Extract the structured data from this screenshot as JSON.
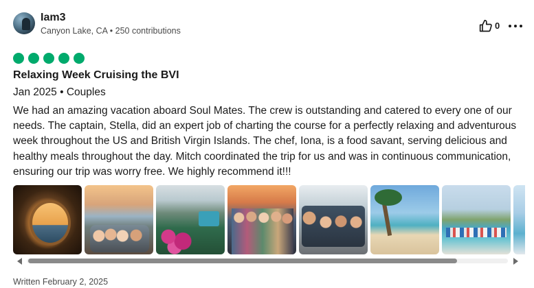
{
  "reviewer": {
    "name": "Iam3",
    "location": "Canyon Lake, CA",
    "separator": "•",
    "contributions": "250 contributions"
  },
  "actions": {
    "helpful_icon": "thumbs-up-icon",
    "helpful_count": "0",
    "more_icon": "more-options-icon"
  },
  "rating": {
    "value": 5,
    "max": 5,
    "color": "#00aa6c"
  },
  "review": {
    "title": "Relaxing Week Cruising the BVI",
    "date": "Jan 2025",
    "separator": "•",
    "trip_type": "Couples",
    "text": "We had an amazing vacation aboard Soul Mates. The crew is outstanding and catered to every one of our needs. The captain, Stella, did an expert job of charting the course for a perfectly relaxing and adventurous week throughout the US and British Virgin Islands. The chef, Iona, is a food savant, serving delicious and healthy meals throughout the day. Mitch coordinated the trip for us and was in continuous communication, ensuring our trip was worry free. We highly recommend it!!!"
  },
  "gallery": {
    "photo_count_visible": 8,
    "scroll_left_icon": "arrow-left-icon",
    "scroll_right_icon": "arrow-right-icon"
  },
  "footer": {
    "written": "Written February 2, 2025"
  }
}
